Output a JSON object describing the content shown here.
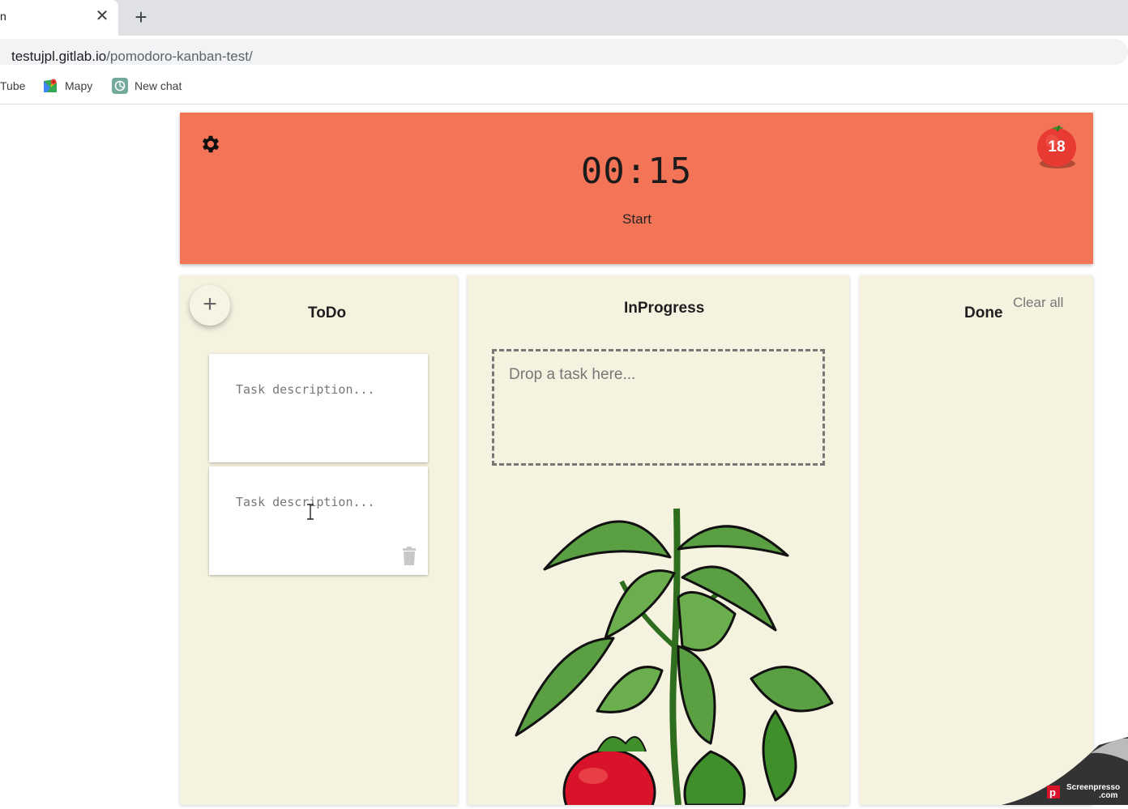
{
  "browser": {
    "tab_title": "n",
    "close_glyph": "✕",
    "new_tab_glyph": "+",
    "url_host": "testujpl.gitlab.io",
    "url_path": "/pomodoro-kanban-test/",
    "bookmarks": [
      {
        "label": "Tube",
        "icon": "youtube-icon"
      },
      {
        "label": "Mapy",
        "icon": "maps-icon"
      },
      {
        "label": "New chat",
        "icon": "chatgpt-icon"
      }
    ]
  },
  "header": {
    "timer": "00:15",
    "start_label": "Start",
    "tomato_count": "18",
    "colors": {
      "background": "#f47458"
    }
  },
  "columns": {
    "todo": {
      "title": "ToDo",
      "add_glyph": "+",
      "cards": [
        {
          "placeholder": "Task description..."
        },
        {
          "placeholder": "Task description..."
        }
      ]
    },
    "in_progress": {
      "title": "InProgress",
      "drop_placeholder": "Drop a task here..."
    },
    "done": {
      "title": "Done",
      "clear_all_label": "Clear all"
    }
  },
  "watermark": {
    "line1": "Screenpresso",
    "line2": ".com"
  }
}
